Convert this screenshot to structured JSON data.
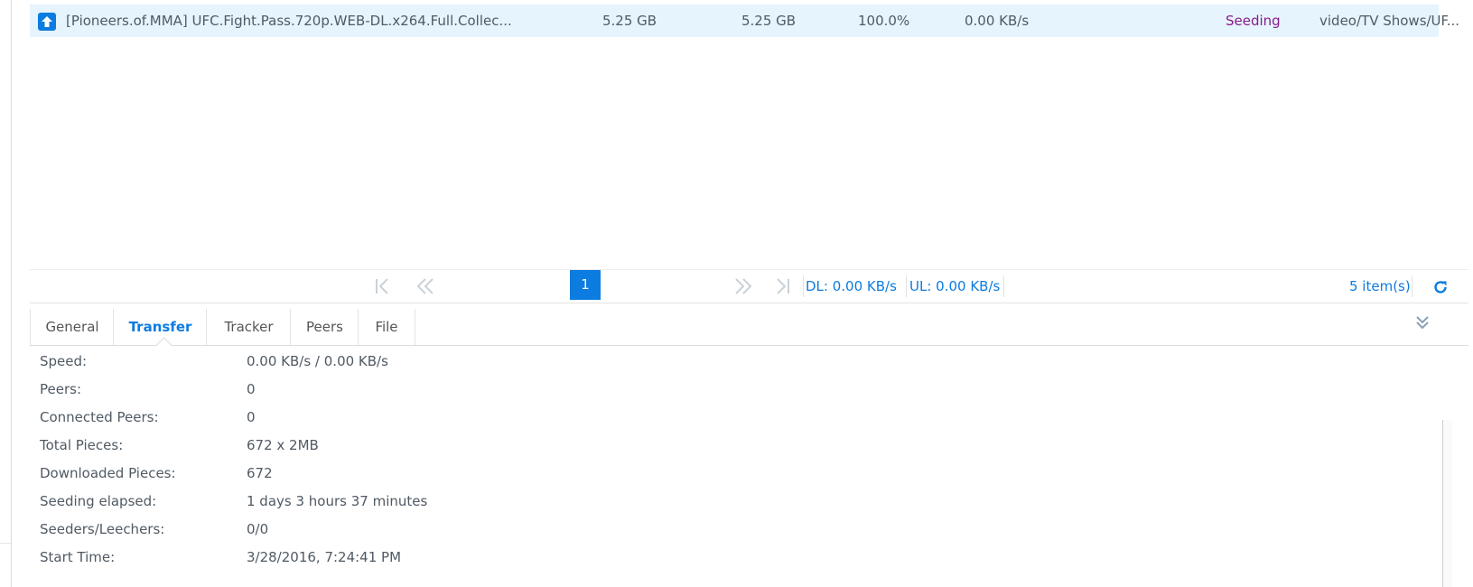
{
  "task": {
    "name": "[Pioneers.of.MMA] UFC.Fight.Pass.720p.WEB-DL.x264.Full.Collec...",
    "size": "5.25 GB",
    "downloaded": "5.25 GB",
    "progress": "100.0%",
    "speed": "0.00 KB/s",
    "status": "Seeding",
    "destination": "video/TV Shows/UF...",
    "icon": "upload-icon",
    "status_color": "#8a1c8a"
  },
  "pager": {
    "page": "1",
    "dl": "DL: 0.00 KB/s",
    "ul": "UL: 0.00 KB/s",
    "items": "5 item(s)"
  },
  "tabs": {
    "general": "General",
    "transfer": "Transfer",
    "tracker": "Tracker",
    "peers": "Peers",
    "file": "File",
    "active": "Transfer"
  },
  "details": [
    {
      "label": "Speed:",
      "value": "0.00 KB/s / 0.00 KB/s"
    },
    {
      "label": "Peers:",
      "value": "0"
    },
    {
      "label": "Connected Peers:",
      "value": "0"
    },
    {
      "label": "Total Pieces:",
      "value": "672 x 2MB"
    },
    {
      "label": "Downloaded Pieces:",
      "value": "672"
    },
    {
      "label": "Seeding elapsed:",
      "value": "1 days 3 hours 37 minutes"
    },
    {
      "label": "Seeders/Leechers:",
      "value": "0/0"
    },
    {
      "label": "Start Time:",
      "value": "3/28/2016, 7:24:41 PM"
    }
  ],
  "colors": {
    "accent": "#0d7ce0",
    "selected_row": "#e6f4fd"
  }
}
